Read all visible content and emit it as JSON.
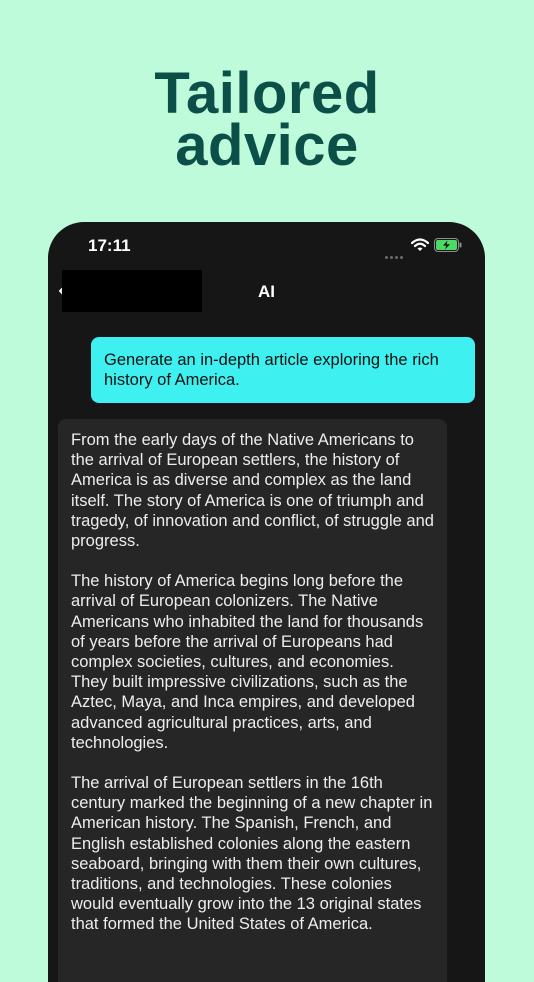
{
  "headline": {
    "line1": "Tailored",
    "line2": "advice"
  },
  "status_bar": {
    "time": "17:11"
  },
  "nav": {
    "title": "AI"
  },
  "chat": {
    "user_message": "Generate an in-depth article exploring the rich history of America.",
    "ai_paragraphs": [
      "From the early days of the Native Americans to the arrival of European settlers, the history of America is as diverse and complex as the land itself. The story of America is one of triumph and tragedy, of innovation and conflict, of struggle and progress.",
      "The history of America begins long before the arrival of European colonizers. The Native Americans who inhabited the land for thousands of years before the arrival of Europeans had complex societies, cultures, and economies. They built impressive civilizations, such as the Aztec, Maya, and Inca empires, and developed advanced agricultural practices, arts, and technologies.",
      "The arrival of European settlers in the 16th century marked the beginning of a new chapter in American history. The Spanish, French, and English established colonies along the eastern seaboard, bringing with them their own cultures, traditions, and technologies. These colonies would eventually grow into the 13 original states that formed the United States of America."
    ]
  },
  "colors": {
    "background": "#bdfbdb",
    "headline": "#0c4f48",
    "user_bubble": "#3ff0f0",
    "ai_bubble": "#262626",
    "battery": "#4cd964"
  },
  "icons": [
    "back-chevron-icon",
    "signal-dots-icon",
    "wifi-icon",
    "battery-charging-icon"
  ]
}
